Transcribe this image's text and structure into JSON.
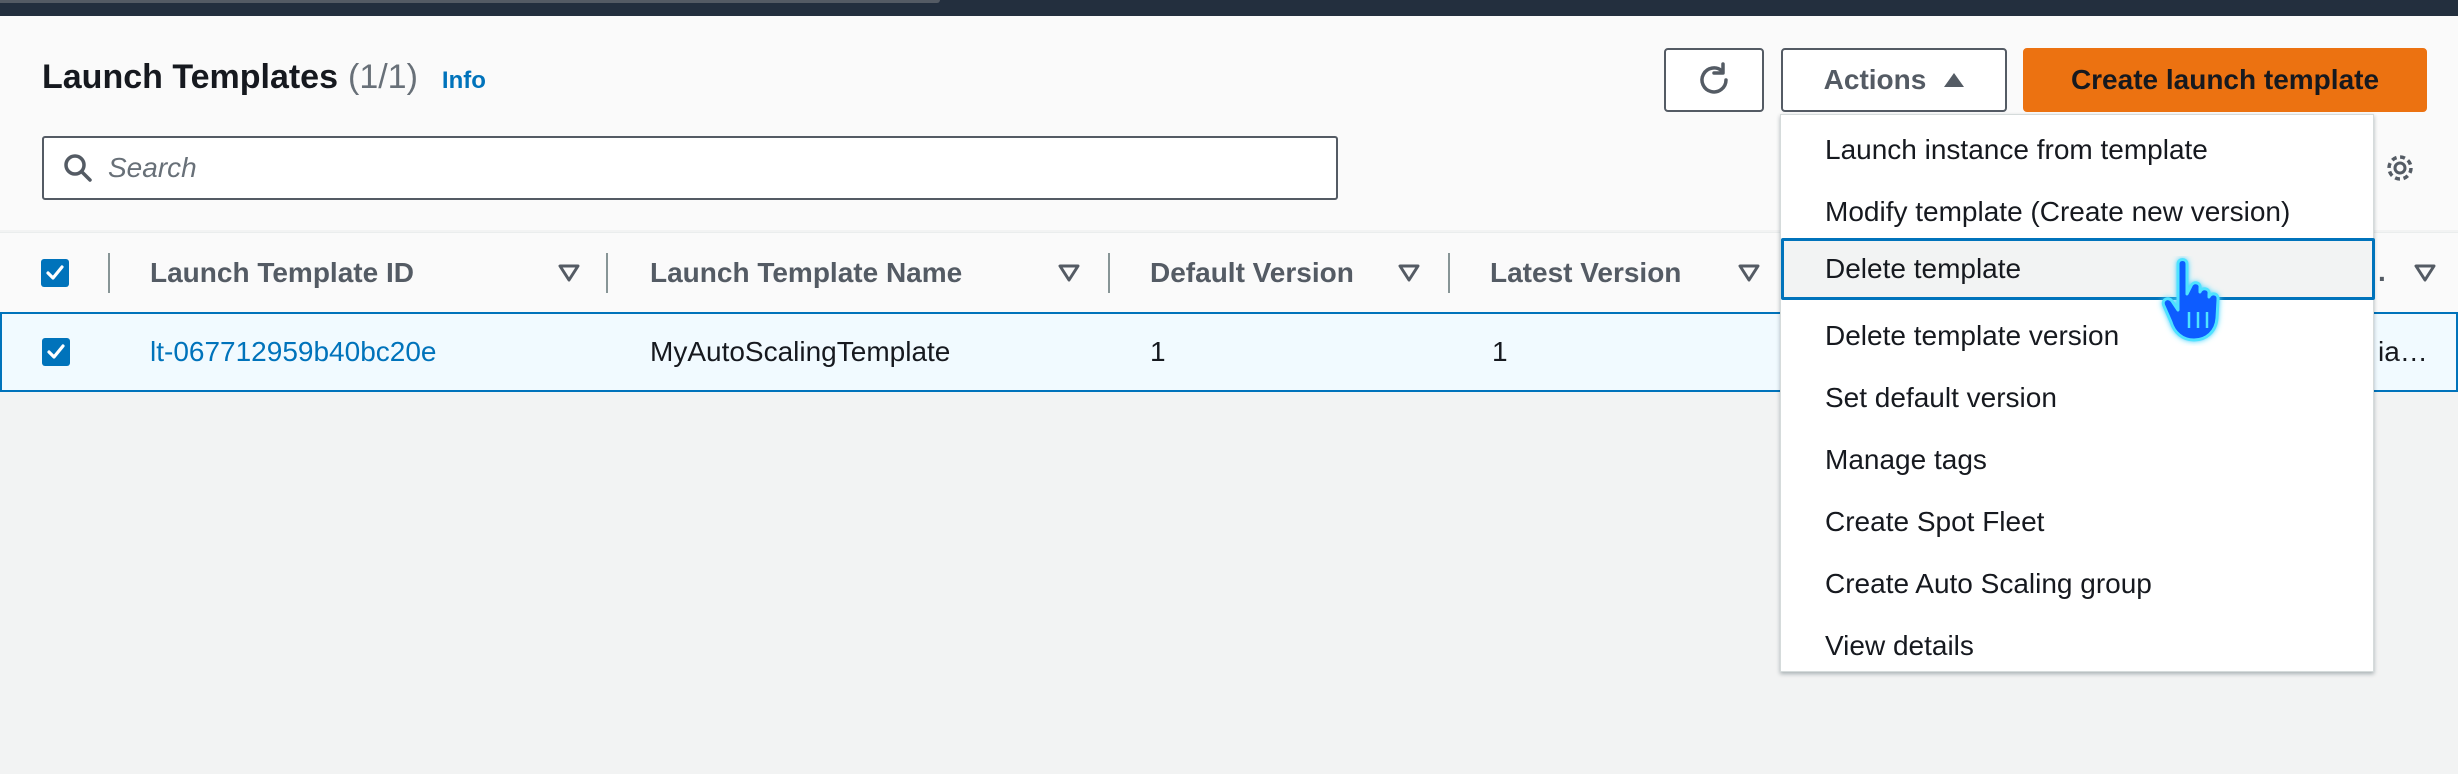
{
  "header": {
    "title": "Launch Templates",
    "count": "(1/1)",
    "info_link": "Info"
  },
  "toolbar": {
    "refresh_icon": "refresh-icon",
    "actions_label": "Actions",
    "create_label": "Create launch template"
  },
  "search": {
    "placeholder": "Search"
  },
  "table": {
    "columns": [
      {
        "label": "Launch Template ID"
      },
      {
        "label": "Launch Template Name"
      },
      {
        "label": "Default Version"
      },
      {
        "label": "Latest Version"
      }
    ],
    "truncated_header": ".",
    "rows": [
      {
        "id": "lt-067712959b40bc20e",
        "name": "MyAutoScalingTemplate",
        "default_version": "1",
        "latest_version": "1",
        "truncated_tail": "ia…",
        "selected": true
      }
    ]
  },
  "actions_menu": {
    "items": [
      {
        "label": "Launch instance from template"
      },
      {
        "label": "Modify template (Create new version)"
      },
      {
        "label": "Delete template",
        "highlighted": true
      },
      {
        "label": "Delete template version"
      },
      {
        "label": "Set default version"
      },
      {
        "label": "Manage tags"
      },
      {
        "label": "Create Spot Fleet"
      },
      {
        "label": "Create Auto Scaling group"
      },
      {
        "label": "View details"
      }
    ]
  },
  "colors": {
    "accent": "#0073bb",
    "primary_button": "#ec7211",
    "text": "#16191f",
    "muted": "#545b64"
  }
}
